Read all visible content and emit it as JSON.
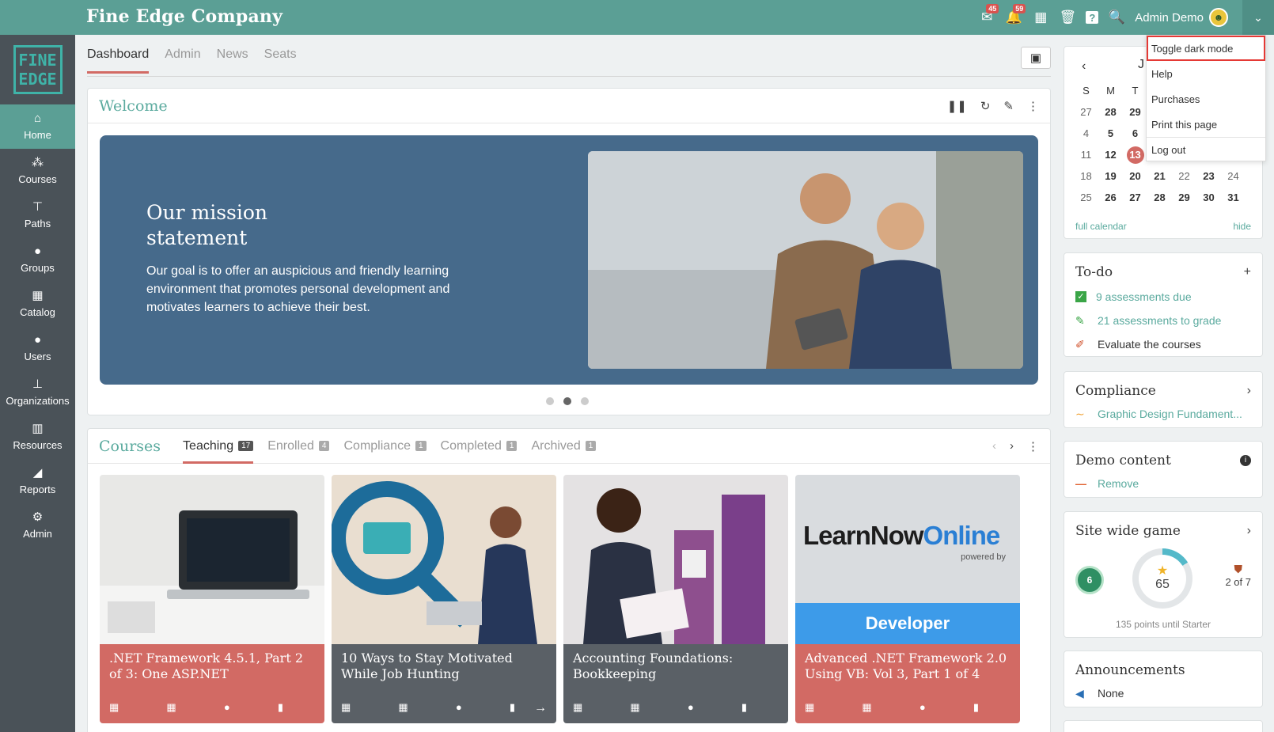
{
  "header": {
    "brand": "Fine Edge Company",
    "mail_badge": "45",
    "bell_badge": "59",
    "user_name": "Admin Demo"
  },
  "logo": {
    "line1": "FINE",
    "line2": "EDGE"
  },
  "sidebar": {
    "items": [
      {
        "label": "Home",
        "icon": "home-icon"
      },
      {
        "label": "Courses",
        "icon": "courses-icon"
      },
      {
        "label": "Paths",
        "icon": "signpost-icon"
      },
      {
        "label": "Groups",
        "icon": "groups-icon"
      },
      {
        "label": "Catalog",
        "icon": "grid-icon"
      },
      {
        "label": "Users",
        "icon": "user-icon"
      },
      {
        "label": "Organizations",
        "icon": "org-icon"
      },
      {
        "label": "Resources",
        "icon": "books-icon"
      },
      {
        "label": "Reports",
        "icon": "chart-icon"
      },
      {
        "label": "Admin",
        "icon": "gear-icon"
      }
    ]
  },
  "tabs": [
    "Dashboard",
    "Admin",
    "News",
    "Seats"
  ],
  "welcome": {
    "title": "Welcome",
    "hero_heading_1": "Our mission",
    "hero_heading_2": "statement",
    "hero_text": "Our goal is to offer an auspicious and friendly learning environment that promotes personal development and motivates learners to achieve their best."
  },
  "courses": {
    "title": "Courses",
    "tabs": [
      {
        "label": "Teaching",
        "count": "17"
      },
      {
        "label": "Enrolled",
        "count": "4"
      },
      {
        "label": "Compliance",
        "count": "1"
      },
      {
        "label": "Completed",
        "count": "1"
      },
      {
        "label": "Archived",
        "count": "1"
      }
    ],
    "items": [
      {
        "title": ".NET Framework 4.5.1, Part 2 of 3: One ASP.NET"
      },
      {
        "title": "10 Ways to Stay Motivated While Job Hunting"
      },
      {
        "title": "Accounting Foundations: Bookkeeping"
      },
      {
        "title": "Advanced .NET Framework 2.0 Using VB: Vol 3, Part 1 of 4"
      }
    ],
    "tile4_brand_1": "LearnNow",
    "tile4_brand_2": "Online",
    "tile4_brand_sub": "powered by",
    "tile4_banner": "Developer"
  },
  "calendar": {
    "month_initial": "J",
    "weekdays": [
      "S",
      "M",
      "T"
    ],
    "rows": [
      [
        "27",
        "28",
        "29"
      ],
      [
        "4",
        "5",
        "6"
      ],
      [
        "11",
        "12",
        "13"
      ],
      [
        "18",
        "19",
        "20",
        "21",
        "22",
        "23",
        "24"
      ],
      [
        "25",
        "26",
        "27",
        "28",
        "29",
        "30",
        "31"
      ]
    ],
    "full_calendar": "full calendar",
    "hide": "hide"
  },
  "todo": {
    "title": "To-do",
    "items": [
      {
        "label": "9 assessments due"
      },
      {
        "label": "21 assessments to grade"
      },
      {
        "label": "Evaluate the courses"
      }
    ]
  },
  "compliance": {
    "title": "Compliance",
    "item": "Graphic Design Fundament..."
  },
  "demo_content": {
    "title": "Demo content",
    "action": "Remove"
  },
  "game": {
    "title": "Site wide game",
    "level": "6",
    "points": "65",
    "points_progress": 0.16,
    "rank": "2 of 7",
    "until": "135 points until Starter"
  },
  "announcements": {
    "title": "Announcements",
    "item": "None"
  },
  "dropdown": {
    "items": [
      "Toggle dark mode",
      "Help",
      "Purchases",
      "Print this page",
      "Log out"
    ]
  }
}
